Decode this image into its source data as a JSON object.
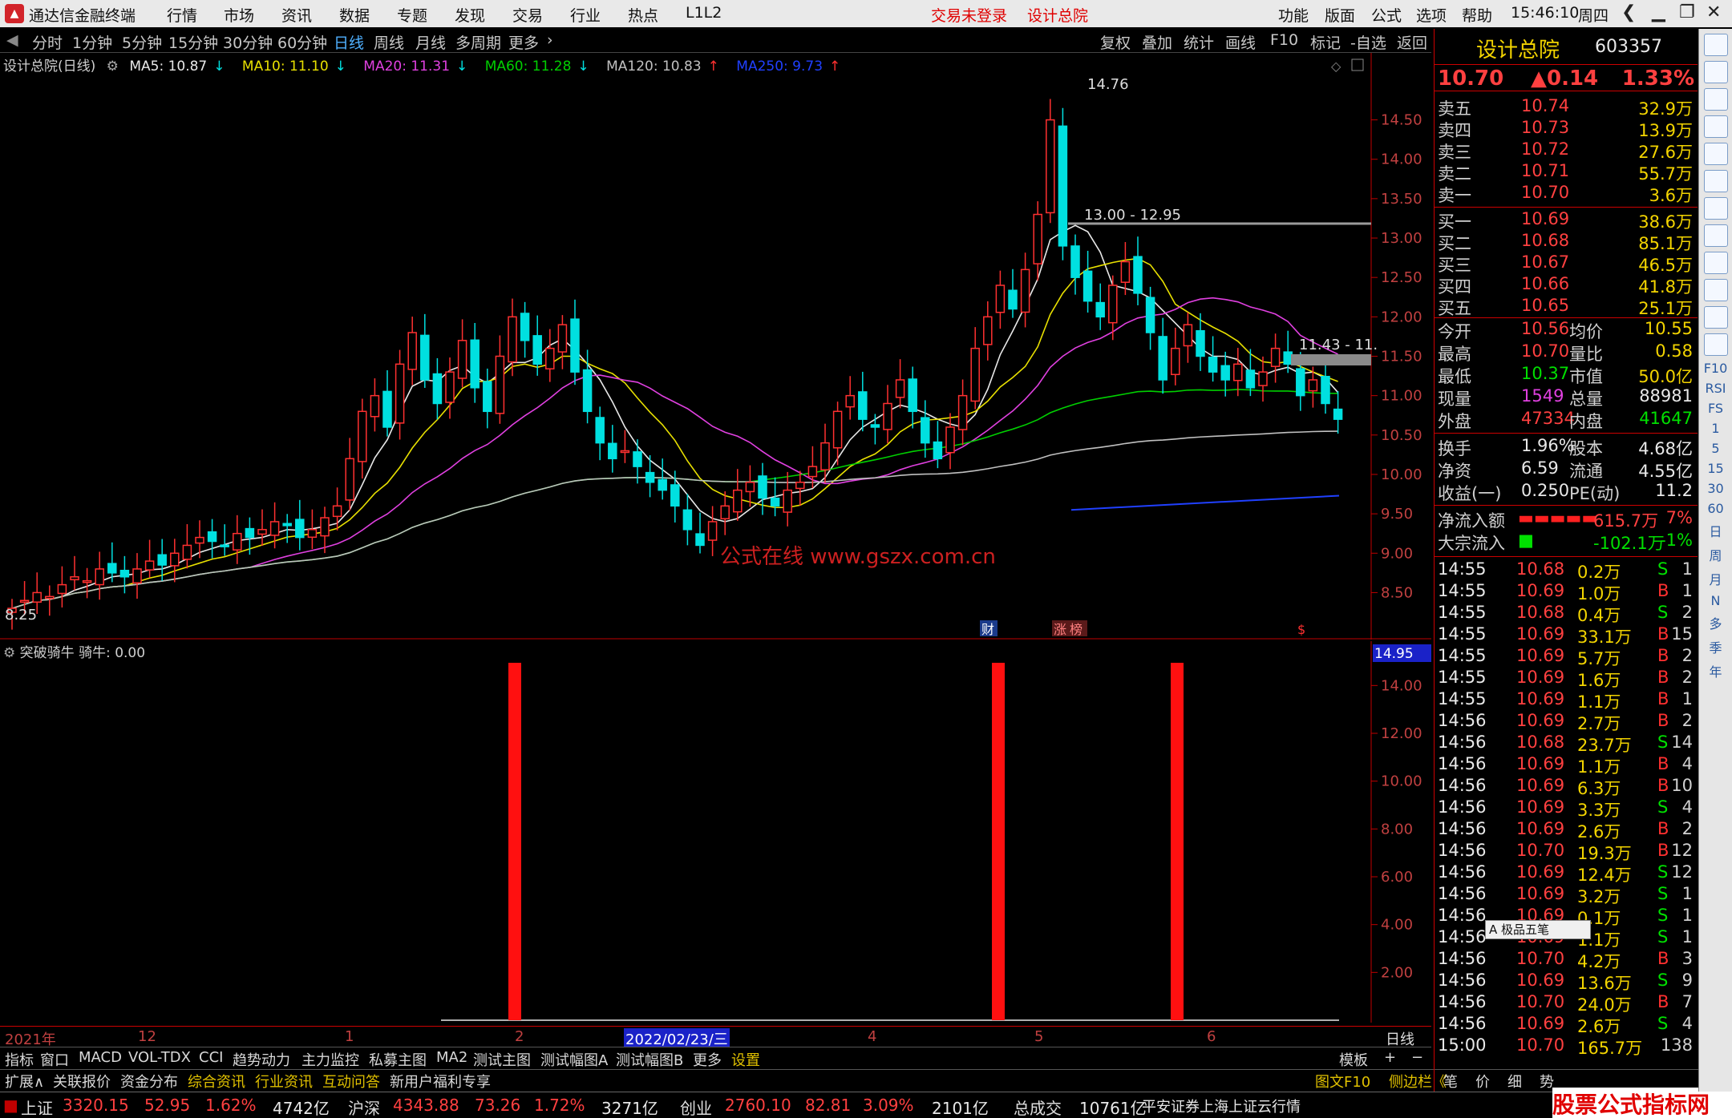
{
  "titlebar": {
    "app_name": "通达信金融终端",
    "menus": [
      "行情",
      "市场",
      "资讯",
      "数据",
      "专题",
      "发现",
      "交易",
      "行业",
      "热点",
      "L1L2"
    ],
    "status": "交易未登录",
    "stock": "设计总院",
    "right_menus": [
      "功能",
      "版面",
      "公式",
      "选项",
      "帮助"
    ],
    "time": "15:46:10",
    "weekday": "周四"
  },
  "period_tabs": [
    "分时",
    "1分钟",
    "5分钟",
    "15分钟",
    "30分钟",
    "60分钟",
    "日线",
    "周线",
    "月线",
    "多周期",
    "更多"
  ],
  "active_period": "日线",
  "tool_buttons": [
    "复权",
    "叠加",
    "统计",
    "画线",
    "F10",
    "标记",
    "-自选",
    "返回"
  ],
  "indicator_line": {
    "title": "设计总院(日线)",
    "items": [
      {
        "text": "MA5: 10.87",
        "arrow": "↓",
        "color": "#e8e8e8"
      },
      {
        "text": "MA10: 11.10",
        "arrow": "↓",
        "color": "#e8e000"
      },
      {
        "text": "MA20: 11.31",
        "arrow": "↓",
        "color": "#e040e0"
      },
      {
        "text": "MA60: 11.28",
        "arrow": "↓",
        "color": "#00d000"
      },
      {
        "text": "MA120: 10.83",
        "arrow": "↑",
        "color": "#c0c0c0"
      },
      {
        "text": "MA250: 9.73",
        "arrow": "↑",
        "color": "#2040ff"
      }
    ]
  },
  "chart_annotations": {
    "high_label": "14.76",
    "low_label": "8.25",
    "range1": "13.00 - 12.95",
    "range2": "11.43 - 11.",
    "watermark": "公式在线  www.gszx.com.cn",
    "markers": [
      "财",
      "涨",
      "榜",
      "$"
    ]
  },
  "chart_data": [
    {
      "type": "candlestick",
      "title": "设计总院(日线)",
      "y_ticks": [
        "14.50",
        "14.00",
        "13.50",
        "13.00",
        "12.50",
        "12.00",
        "11.50",
        "11.00",
        "10.50",
        "10.00",
        "9.50",
        "9.00",
        "8.50"
      ],
      "ylim": [
        8.25,
        14.76
      ],
      "series": [
        {
          "name": "MA5",
          "last": 10.87
        },
        {
          "name": "MA10",
          "last": 11.1
        },
        {
          "name": "MA20",
          "last": 11.31
        },
        {
          "name": "MA60",
          "last": 11.28
        },
        {
          "name": "MA120",
          "last": 10.83
        },
        {
          "name": "MA250",
          "last": 9.73
        }
      ]
    },
    {
      "type": "bar",
      "title": "突破骑牛",
      "subtitle": "骑牛: 0.00",
      "y_ticks": [
        "14.00",
        "12.00",
        "10.00",
        "8.00",
        "6.00",
        "4.00",
        "2.00"
      ],
      "ylim": [
        0,
        14.95
      ],
      "top_label": "14.95",
      "bars": [
        {
          "date": "2022-02",
          "value": 14.95
        },
        {
          "date": "2022-05",
          "value": 14.95
        },
        {
          "date": "2022-06",
          "value": 14.95
        }
      ]
    }
  ],
  "date_axis": {
    "labels": [
      "2021年",
      "12",
      "1",
      "2",
      "2022/02/23/三",
      "4",
      "5",
      "6"
    ],
    "period": "日线"
  },
  "bottom_tabs1": [
    "指标",
    "窗口",
    "MACD",
    "VOL-TDX",
    "CCI",
    "趋势动力",
    "主力监控",
    "私募主图",
    "MA2",
    "测试主图",
    "测试幅图A",
    "测试幅图B",
    "更多",
    "设置"
  ],
  "bottom_tabs1_right": "模板",
  "bottom_tabs2": [
    "扩展∧",
    "关联报价",
    "资金分布",
    "综合资讯",
    "行业资讯",
    "互动问答",
    "新用户福利专享"
  ],
  "bottom_tabs2_right": [
    "图文F10",
    "侧边栏《",
    "笔",
    "价",
    "细",
    "势"
  ],
  "status_indices": [
    {
      "name": "上证",
      "value": "3320.15",
      "change": "52.95",
      "pct": "1.62%",
      "amount": "4742亿"
    },
    {
      "name": "沪深",
      "value": "4343.88",
      "change": "73.26",
      "pct": "1.72%",
      "amount": "3271亿"
    },
    {
      "name": "创业",
      "value": "2760.10",
      "change": "82.81",
      "pct": "3.09%",
      "amount": "2101亿"
    }
  ],
  "status_total": {
    "label": "总成交",
    "value": "10761亿",
    "source": "平安证券上海上证云行情"
  },
  "quote": {
    "name": "设计总院",
    "code": "603357",
    "price": "10.70",
    "change": "▲0.14",
    "pct": "1.33%",
    "asks": [
      {
        "label": "卖五",
        "price": "10.74",
        "vol": "32.9万"
      },
      {
        "label": "卖四",
        "price": "10.73",
        "vol": "13.9万"
      },
      {
        "label": "卖三",
        "price": "10.72",
        "vol": "27.6万"
      },
      {
        "label": "卖二",
        "price": "10.71",
        "vol": "55.7万"
      },
      {
        "label": "卖一",
        "price": "10.70",
        "vol": "3.6万"
      }
    ],
    "bids": [
      {
        "label": "买一",
        "price": "10.69",
        "vol": "38.6万"
      },
      {
        "label": "买二",
        "price": "10.68",
        "vol": "85.1万"
      },
      {
        "label": "买三",
        "price": "10.67",
        "vol": "46.5万"
      },
      {
        "label": "买四",
        "price": "10.66",
        "vol": "41.8万"
      },
      {
        "label": "买五",
        "price": "10.65",
        "vol": "25.1万"
      }
    ],
    "stats": [
      {
        "l1": "今开",
        "v1": "10.56",
        "l2": "均价",
        "v2": "10.55"
      },
      {
        "l1": "最高",
        "v1": "10.70",
        "l2": "量比",
        "v2": "0.58"
      },
      {
        "l1": "最低",
        "v1": "10.37",
        "l2": "市值",
        "v2": "50.0亿"
      },
      {
        "l1": "现量",
        "v1": "1549",
        "l2": "总量",
        "v2": "88981"
      },
      {
        "l1": "外盘",
        "v1": "47334",
        "l2": "内盘",
        "v2": "41647"
      }
    ],
    "stats2": [
      {
        "l1": "换手",
        "v1": "1.96%",
        "l2": "股本",
        "v2": "4.68亿"
      },
      {
        "l1": "净资",
        "v1": "6.59",
        "l2": "流通",
        "v2": "4.55亿"
      },
      {
        "l1": "收益(一)",
        "v1": "0.250",
        "l2": "PE(动)",
        "v2": "11.2"
      }
    ],
    "flows": [
      {
        "label": "净流入额",
        "value": "615.7万",
        "pct": "7%"
      },
      {
        "label": "大宗流入",
        "value": "-102.1万",
        "pct": "-1%"
      }
    ],
    "ticks": [
      {
        "t": "14:55",
        "p": "10.68",
        "v": "0.2万",
        "d": "S",
        "n": "1"
      },
      {
        "t": "14:55",
        "p": "10.69",
        "v": "1.0万",
        "d": "B",
        "n": "1"
      },
      {
        "t": "14:55",
        "p": "10.68",
        "v": "0.4万",
        "d": "S",
        "n": "2"
      },
      {
        "t": "14:55",
        "p": "10.69",
        "v": "33.1万",
        "d": "B",
        "n": "15"
      },
      {
        "t": "14:55",
        "p": "10.69",
        "v": "5.7万",
        "d": "B",
        "n": "2"
      },
      {
        "t": "14:55",
        "p": "10.69",
        "v": "1.6万",
        "d": "B",
        "n": "2"
      },
      {
        "t": "14:55",
        "p": "10.69",
        "v": "1.1万",
        "d": "B",
        "n": "1"
      },
      {
        "t": "14:56",
        "p": "10.69",
        "v": "2.7万",
        "d": "B",
        "n": "2"
      },
      {
        "t": "14:56",
        "p": "10.68",
        "v": "23.7万",
        "d": "S",
        "n": "14"
      },
      {
        "t": "14:56",
        "p": "10.69",
        "v": "1.1万",
        "d": "B",
        "n": "4"
      },
      {
        "t": "14:56",
        "p": "10.69",
        "v": "6.3万",
        "d": "B",
        "n": "10"
      },
      {
        "t": "14:56",
        "p": "10.69",
        "v": "3.3万",
        "d": "S",
        "n": "4"
      },
      {
        "t": "14:56",
        "p": "10.69",
        "v": "2.6万",
        "d": "B",
        "n": "2"
      },
      {
        "t": "14:56",
        "p": "10.70",
        "v": "19.3万",
        "d": "B",
        "n": "12"
      },
      {
        "t": "14:56",
        "p": "10.69",
        "v": "12.4万",
        "d": "S",
        "n": "12"
      },
      {
        "t": "14:56",
        "p": "10.69",
        "v": "3.2万",
        "d": "S",
        "n": "1"
      },
      {
        "t": "14:56",
        "p": "10.69",
        "v": "0.1万",
        "d": "S",
        "n": "1"
      },
      {
        "t": "14:56",
        "p": "10.69",
        "v": "1.1万",
        "d": "S",
        "n": "1"
      },
      {
        "t": "14:56",
        "p": "10.70",
        "v": "4.2万",
        "d": "B",
        "n": "3"
      },
      {
        "t": "14:56",
        "p": "10.69",
        "v": "13.6万",
        "d": "S",
        "n": "9"
      },
      {
        "t": "14:56",
        "p": "10.70",
        "v": "24.0万",
        "d": "B",
        "n": "7"
      },
      {
        "t": "14:56",
        "p": "10.69",
        "v": "2.6万",
        "d": "S",
        "n": "4"
      },
      {
        "t": "15:00",
        "p": "10.70",
        "v": "165.7万",
        "d": "",
        "n": "138"
      }
    ]
  },
  "ime_box": "A 极品五笔",
  "sidebar_labels": [
    "F10",
    "RSI",
    "FS",
    "1",
    "5",
    "15",
    "30",
    "60",
    "日",
    "周",
    "月",
    "N",
    "多",
    "季",
    "年"
  ],
  "brand_watermark": "股票公式指标网 www.gszx.com.cn",
  "colors": {
    "up": "#ff3030",
    "down": "#00e0e0",
    "ma5": "#e8e8e8",
    "ma10": "#e8e000",
    "ma20": "#e040e0",
    "ma60": "#00d000",
    "ma120": "#c0c0c0",
    "ma250": "#2040ff",
    "accent": "#f3d400"
  }
}
